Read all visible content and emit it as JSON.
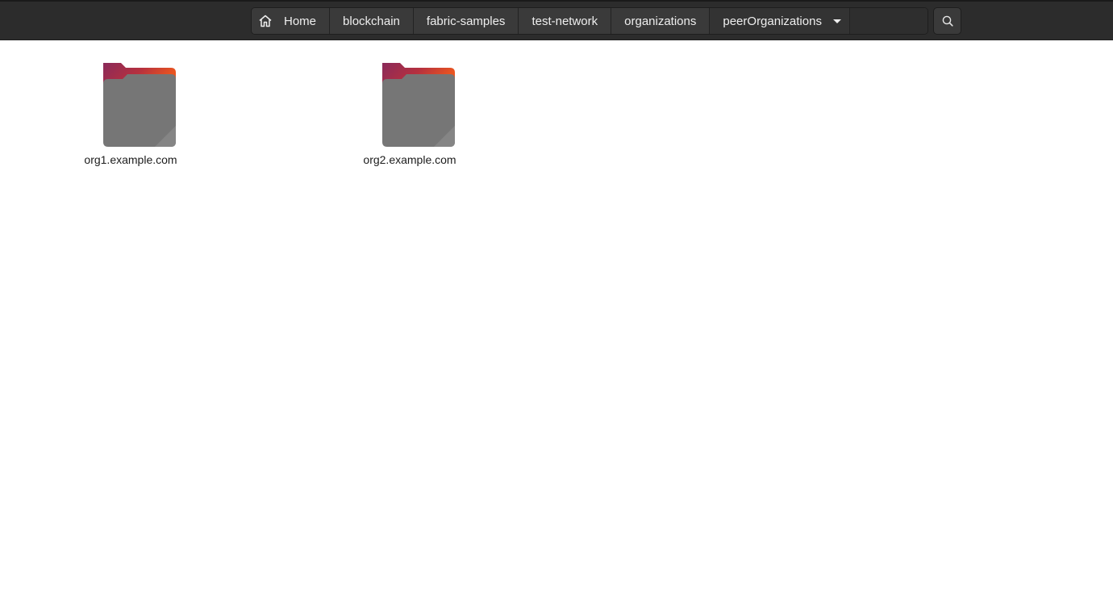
{
  "pathbar": {
    "crumbs": [
      {
        "label": "Home",
        "icon": "home-icon"
      },
      {
        "label": "blockchain"
      },
      {
        "label": "fabric-samples"
      },
      {
        "label": "test-network"
      },
      {
        "label": "organizations"
      },
      {
        "label": "peerOrganizations",
        "icon": "chevron-down-icon"
      }
    ]
  },
  "search": {
    "icon": "search-icon"
  },
  "files": [
    {
      "name": "org1.example.com",
      "type": "folder"
    },
    {
      "name": "org2.example.com",
      "type": "folder"
    }
  ],
  "colors": {
    "headerbar": "#2c2c2c",
    "folder_body": "#767676",
    "folder_tab_start": "#8a2a5a",
    "folder_tab_end": "#e95420"
  }
}
